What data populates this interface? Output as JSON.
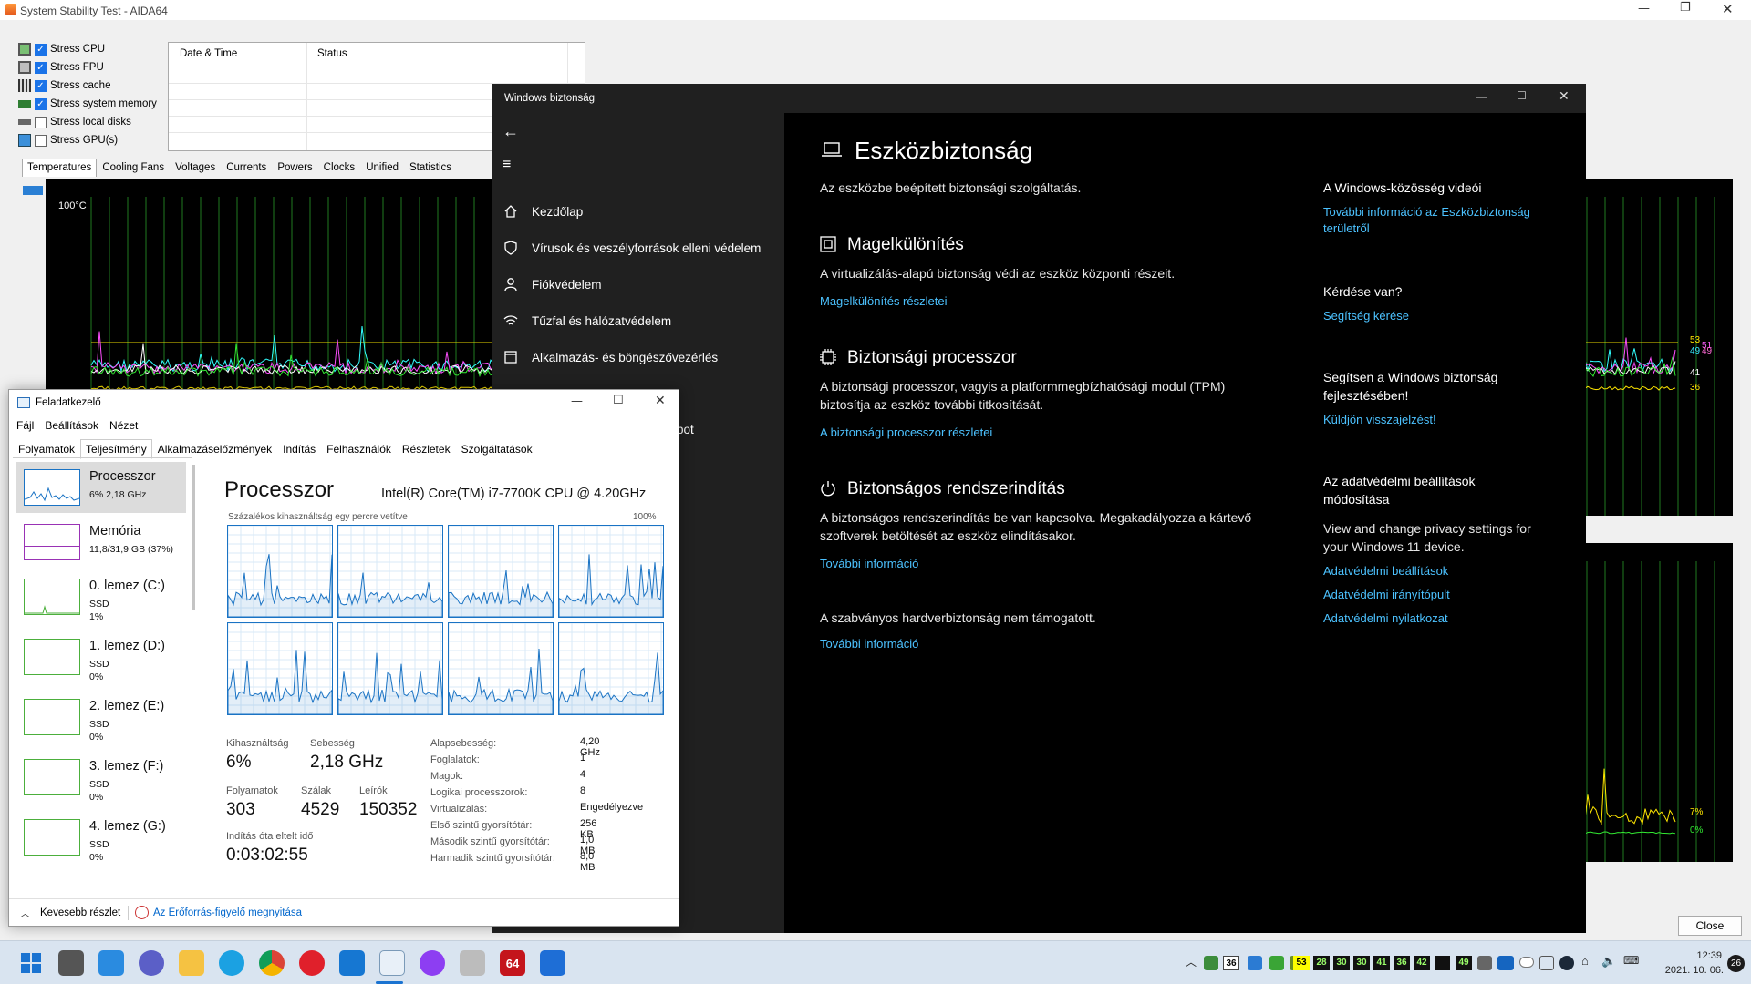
{
  "aida": {
    "title": "System Stability Test - AIDA64",
    "stress": [
      {
        "label": "Stress CPU",
        "checked": true
      },
      {
        "label": "Stress FPU",
        "checked": true
      },
      {
        "label": "Stress cache",
        "checked": true
      },
      {
        "label": "Stress system memory",
        "checked": true
      },
      {
        "label": "Stress local disks",
        "checked": false
      },
      {
        "label": "Stress GPU(s)",
        "checked": false
      }
    ],
    "table_headers": [
      "Date & Time",
      "Status"
    ],
    "tabs": [
      "Temperatures",
      "Cooling Fans",
      "Voltages",
      "Currents",
      "Powers",
      "Clocks",
      "Unified",
      "Statistics"
    ],
    "active_tab": "Temperatures",
    "graph_top_label": "100°C",
    "graph_right_labels": [
      "53",
      "51",
      "49",
      "49",
      "41",
      "36"
    ],
    "graph2_right_labels": [
      "7%",
      "0%"
    ],
    "close_label": "Close"
  },
  "security": {
    "title": "Windows biztonság",
    "nav": [
      {
        "icon": "home-icon",
        "label": "Kezdőlap"
      },
      {
        "icon": "shield-icon",
        "label": "Vírusok és veszélyforrások elleni védelem"
      },
      {
        "icon": "person-icon",
        "label": "Fiókvédelem"
      },
      {
        "icon": "wifi-icon",
        "label": "Tűzfal és hálózatvédelem"
      },
      {
        "icon": "app-browser-icon",
        "label": "Alkalmazás- és böngészővezérlés"
      }
    ],
    "hidden_nav_fragment": "bot",
    "page_title": "Eszközbiztonság",
    "page_desc": "Az eszközbe beépített biztonsági szolgáltatás.",
    "sections": [
      {
        "title": "Magelkülönítés",
        "desc": "A virtualizálás-alapú biztonság védi az eszköz központi részeit.",
        "link": "Magelkülönítés részletei"
      },
      {
        "title": "Biztonsági processzor",
        "desc": "A biztonsági processzor, vagyis a platformmegbízhatósági modul (TPM) biztosítja az eszköz további titkosítását.",
        "link": "A biztonsági processzor részletei"
      },
      {
        "title": "Biztonságos rendszerindítás",
        "desc": "A biztonságos rendszerindítás be van kapcsolva. Megakadályozza a kártevő szoftverek betöltését az eszköz elindításakor.",
        "link": "További információ"
      }
    ],
    "hw_note": "A szabványos hardverbiztonság nem támogatott.",
    "hw_link": "További információ",
    "right": {
      "videos_title": "A Windows-közösség videói",
      "videos_link": "További információ az Eszközbiztonság területről",
      "question_title": "Kérdése van?",
      "question_link": "Segítség kérése",
      "improve_title": "Segítsen a Windows biztonság fejlesztésében!",
      "improve_link": "Küldjön visszajelzést!",
      "privacy_title": "Az adatvédelmi beállítások módosítása",
      "privacy_desc": "View and change privacy settings for your Windows 11 device.",
      "privacy_links": [
        "Adatvédelmi beállítások",
        "Adatvédelmi irányítópult",
        "Adatvédelmi nyilatkozat"
      ]
    }
  },
  "taskmgr": {
    "title": "Feladatkezelő",
    "menu": [
      "Fájl",
      "Beállítások",
      "Nézet"
    ],
    "tabs": [
      "Folyamatok",
      "Teljesítmény",
      "Alkalmazáselőzmények",
      "Indítás",
      "Felhasználók",
      "Részletek",
      "Szolgáltatások"
    ],
    "active_tab": "Teljesítmény",
    "side": [
      {
        "name": "Processzor",
        "sub1": "6% 2,18 GHz",
        "sub2": ""
      },
      {
        "name": "Memória",
        "sub1": "11,8/31,9 GB (37%)",
        "sub2": ""
      },
      {
        "name": "0. lemez (C:)",
        "sub1": "SSD",
        "sub2": "1%"
      },
      {
        "name": "1. lemez (D:)",
        "sub1": "SSD",
        "sub2": "0%"
      },
      {
        "name": "2. lemez (E:)",
        "sub1": "SSD",
        "sub2": "0%"
      },
      {
        "name": "3. lemez (F:)",
        "sub1": "SSD",
        "sub2": "0%"
      },
      {
        "name": "4. lemez (G:)",
        "sub1": "SSD",
        "sub2": "0%"
      }
    ],
    "cpu_title": "Processzor",
    "cpu_model": "Intel(R) Core(TM) i7-7700K CPU @ 4.20GHz",
    "graph_caption": "Százalékos kihasználtság egy percre vetítve",
    "graph_max": "100%",
    "stats": {
      "util_label": "Kihasználtság",
      "util": "6%",
      "speed_label": "Sebesség",
      "speed": "2,18 GHz",
      "proc_label": "Folyamatok",
      "proc": "303",
      "threads_label": "Szálak",
      "threads": "4529",
      "handles_label": "Leírók",
      "handles": "150352",
      "uptime_label": "Indítás óta eltelt idő",
      "uptime": "0:03:02:55"
    },
    "specs": [
      {
        "k": "Alapsebesség:",
        "v": "4,20 GHz"
      },
      {
        "k": "Foglalatok:",
        "v": "1"
      },
      {
        "k": "Magok:",
        "v": "4"
      },
      {
        "k": "Logikai processzorok:",
        "v": "8"
      },
      {
        "k": "Virtualizálás:",
        "v": "Engedélyezve"
      },
      {
        "k": "Első szintű gyorsítótár:",
        "v": "256 KB"
      },
      {
        "k": "Második szintű gyorsítótár:",
        "v": "1,0 MB"
      },
      {
        "k": "Harmadik szintű gyorsítótár:",
        "v": "8,0 MB"
      }
    ],
    "fewer_details": "Kevesebb részlet",
    "resmon": "Az Erőforrás-figyelő megnyitása"
  },
  "taskbar": {
    "tray_numbers": [
      "36",
      "53",
      "28",
      "30",
      "30",
      "41",
      "36",
      "42",
      "49"
    ],
    "time": "12:39",
    "date": "2021. 10. 06.",
    "notif": "26",
    "aida_badge": "64"
  }
}
